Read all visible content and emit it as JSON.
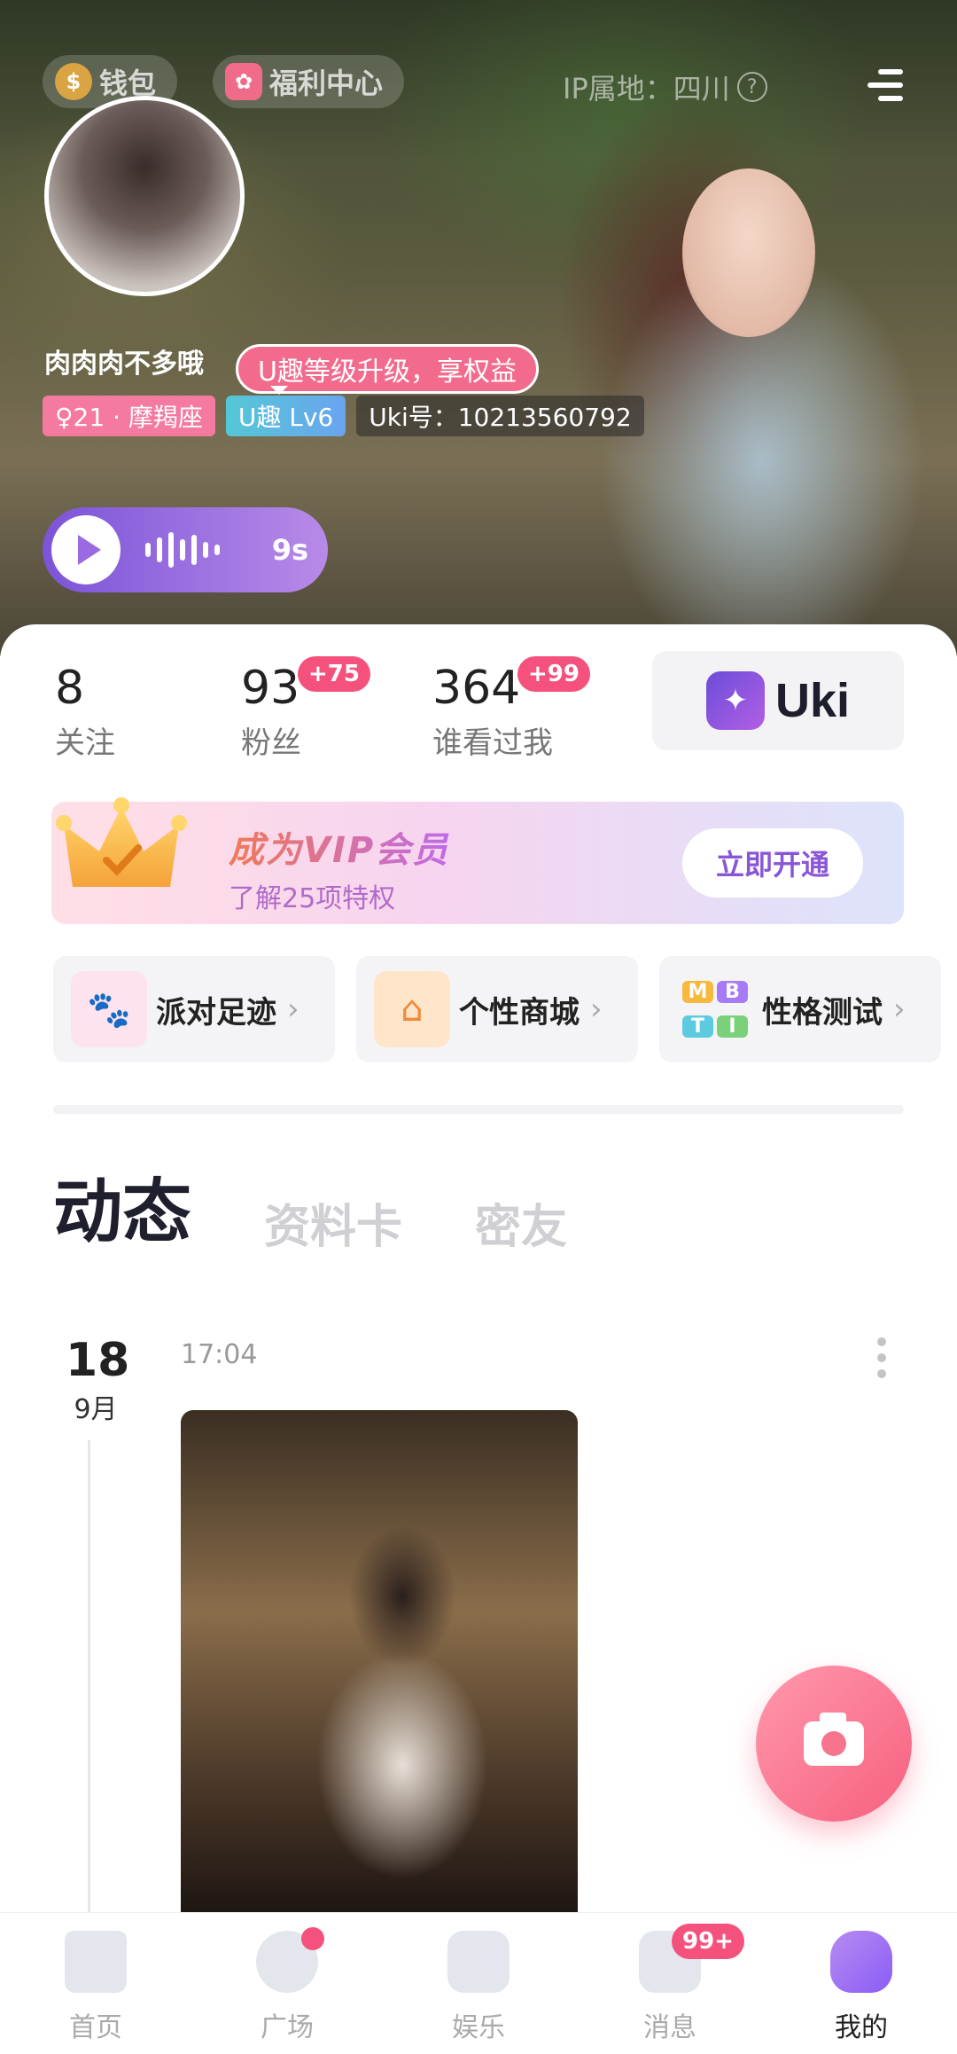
{
  "header": {
    "wallet_label": "钱包",
    "welfare_label": "福利中心",
    "ip_location": "IP属地：四川",
    "help_mark": "?"
  },
  "profile": {
    "nickname": "肉肉肉不多哦",
    "level_tip": "U趣等级升级，享权益",
    "age_tag": "♀21 · 摩羯座",
    "level_tag": "U趣 Lv6",
    "uki_id": "Uki号：10213560792",
    "voice_duration": "9s"
  },
  "stats": {
    "following": {
      "count": "8",
      "label": "关注"
    },
    "fans": {
      "count": "93",
      "label": "粉丝",
      "badge": "+75"
    },
    "visitors": {
      "count": "364",
      "label": "谁看过我",
      "badge": "+99"
    },
    "uki_brand": "Uki"
  },
  "vip": {
    "title": "成为VIP会员",
    "subtitle": "了解25项特权",
    "button": "立即开通"
  },
  "features": [
    {
      "label": "派对足迹"
    },
    {
      "label": "个性商城"
    },
    {
      "label": "性格测试",
      "mbti": [
        "M",
        "B",
        "T",
        "I"
      ]
    }
  ],
  "tabs": [
    "动态",
    "资料卡",
    "密友"
  ],
  "post": {
    "day": "18",
    "month": "9月",
    "time": "17:04"
  },
  "nav": {
    "items": [
      {
        "label": "首页"
      },
      {
        "label": "广场"
      },
      {
        "label": "娱乐"
      },
      {
        "label": "消息",
        "badge": "99+"
      },
      {
        "label": "我的"
      }
    ]
  },
  "colors": {
    "accent_purple": "#8b5cf6",
    "badge_red": "#f4527c",
    "fab_pink": "#f7607f"
  }
}
